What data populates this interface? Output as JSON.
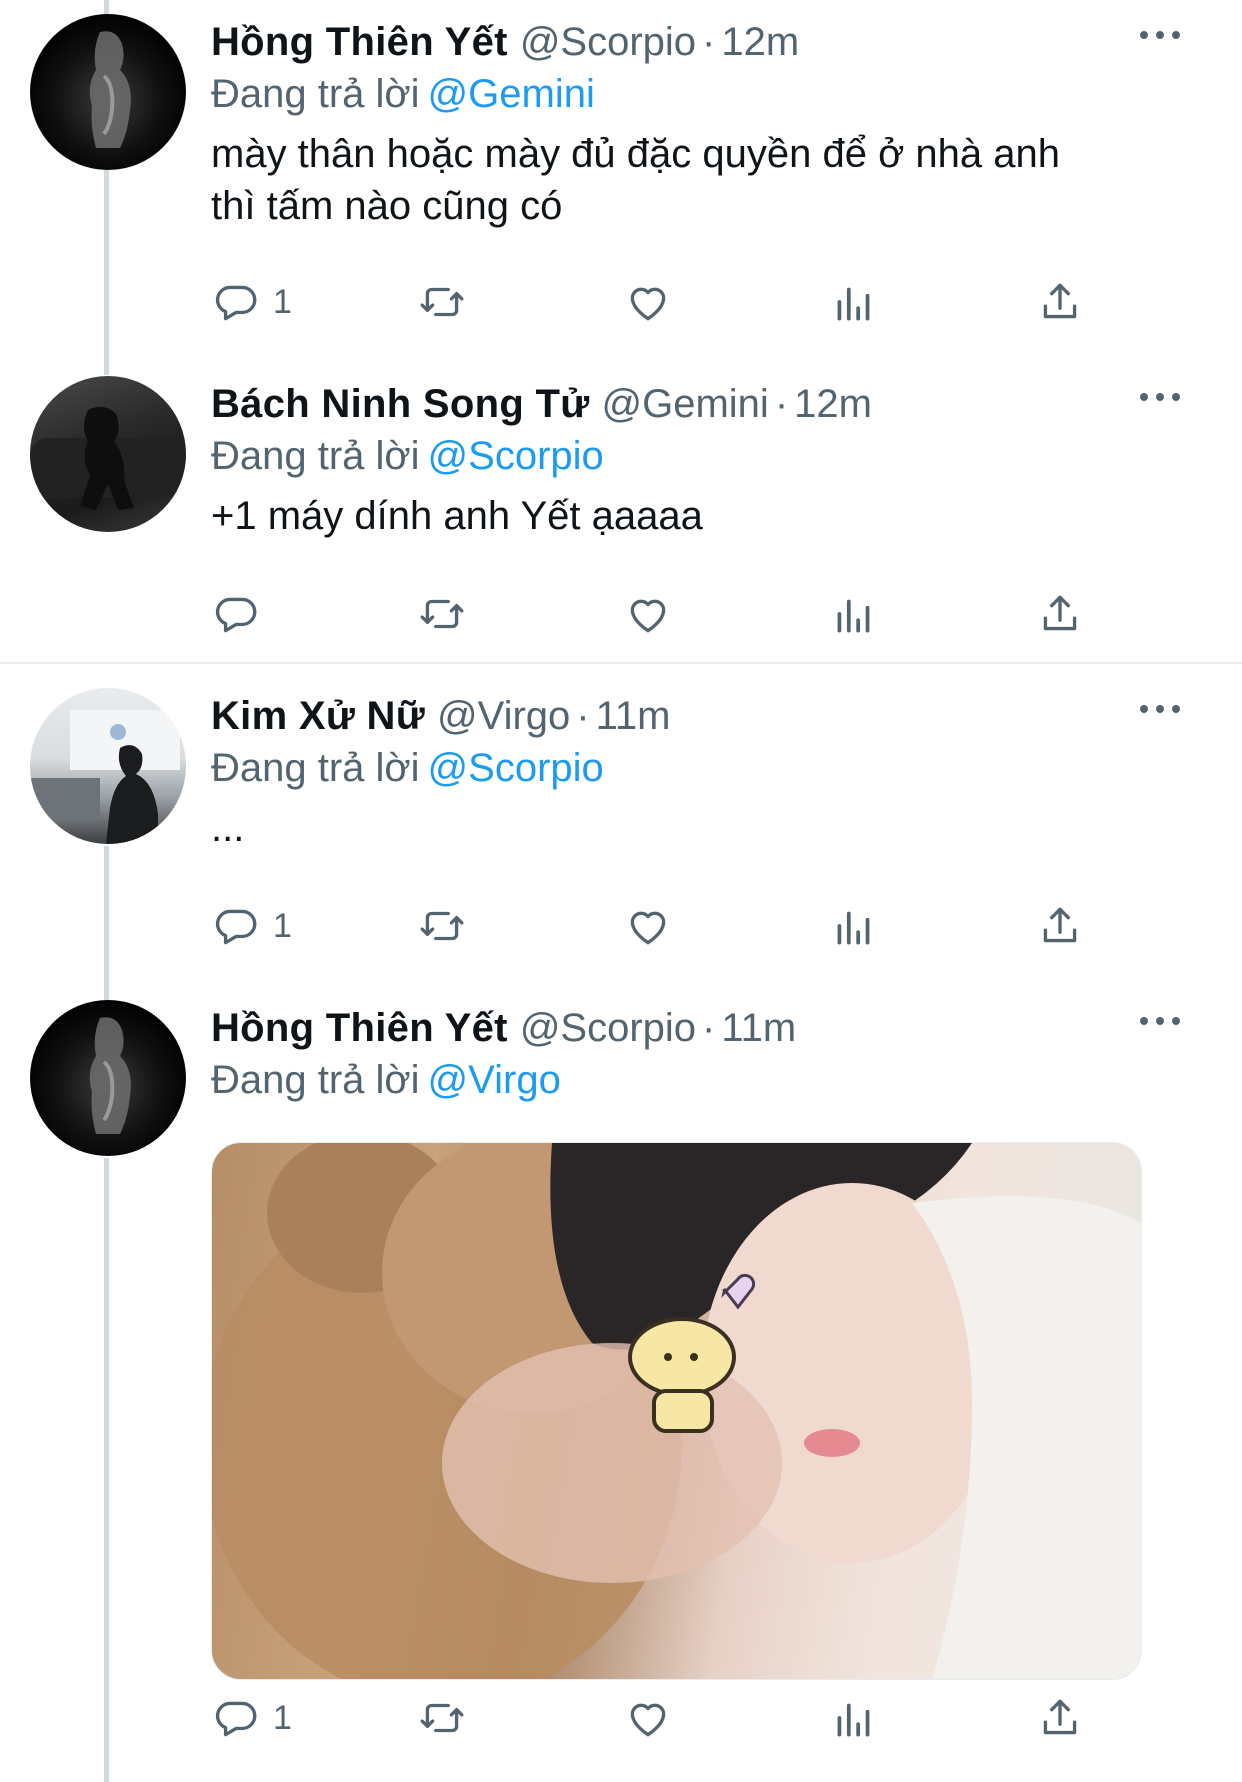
{
  "tweets": [
    {
      "name": "Hồng Thiên Yết",
      "handle": "@Scorpio",
      "time": "12m",
      "replying_label": "Đang trả lời",
      "replying_to": "@Gemini",
      "text": "mày thân hoặc mày đủ đặc quyền để ở nhà anh\nthì tấm nào cũng có",
      "reply_count": "1"
    },
    {
      "name": "Bách Ninh Song Tử",
      "handle": "@Gemini",
      "time": "12m",
      "replying_label": "Đang trả lời",
      "replying_to": "@Scorpio",
      "text": "+1 máy dính anh Yết ạaaaa",
      "reply_count": ""
    },
    {
      "name": "Kim Xử Nữ",
      "handle": "@Virgo",
      "time": "11m",
      "replying_label": "Đang trả lời",
      "replying_to": "@Scorpio",
      "text": "...",
      "reply_count": "1"
    },
    {
      "name": "Hồng Thiên Yết",
      "handle": "@Scorpio",
      "time": "11m",
      "replying_label": "Đang trả lời",
      "replying_to": "@Virgo",
      "text": "",
      "reply_count": "1"
    }
  ],
  "separator": "·",
  "colors": {
    "text": "#0f1419",
    "secondary": "#536471",
    "mention": "#1d9bf0",
    "thread_line": "#cfd9de",
    "divider": "#e6ecf0"
  },
  "icons": [
    "reply-icon",
    "retweet-icon",
    "like-icon",
    "views-icon",
    "share-icon",
    "more-icon"
  ]
}
